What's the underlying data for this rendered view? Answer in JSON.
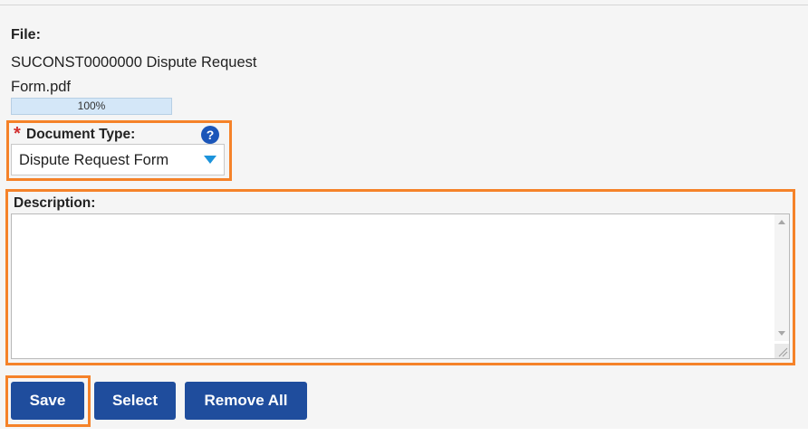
{
  "file": {
    "label": "File:",
    "name_line1": "SUCONST0000000 Dispute Request",
    "name_line2": "Form.pdf",
    "progress_text": "100%",
    "progress_value": 1.0
  },
  "document_type": {
    "required_marker": "*",
    "label": "Document Type:",
    "help_icon": "question-circle-icon",
    "help_glyph": "?",
    "selected_value": "Dispute Request Form"
  },
  "description": {
    "label": "Description:",
    "value": ""
  },
  "buttons": {
    "save": "Save",
    "select": "Select",
    "remove_all": "Remove All"
  },
  "colors": {
    "highlight": "#f58229",
    "button": "#1f4d9d",
    "required": "#d22f2f",
    "help": "#1b56b9",
    "dropdown_arrow": "#1c93db"
  }
}
